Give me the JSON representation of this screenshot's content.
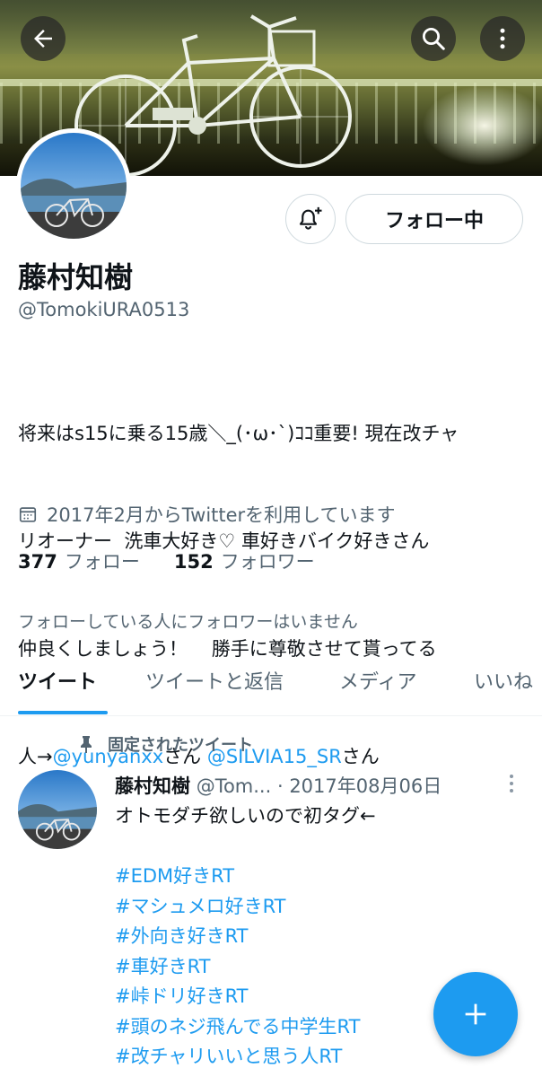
{
  "profile": {
    "name": "藤村知樹",
    "handle": "@TomokiURA0513",
    "bio_lines": [
      "将来はs15に乗る15歳＼_(･ω･`)ｺｺ重要! 現在改チャ",
      "リオーナー  洗車大好き♡ 車好きバイク好きさん",
      "仲良くしましょう！    勝手に尊敬させて貰ってる"
    ],
    "bio_last_prefix": "人→",
    "bio_mention_1": "@yunyanxx",
    "bio_san_1": "さん ",
    "bio_mention_2": "@SILVIA15_SR",
    "bio_san_2": "さん",
    "joined": "2017年2月からTwitterを利用しています",
    "following_count": "377",
    "following_label": "フォロー",
    "followers_count": "152",
    "followers_label": "フォロワー",
    "no_followers_you_know": "フォローしている人にフォロワーはいません",
    "follow_button": "フォロー中"
  },
  "tabs": [
    {
      "label": "ツイート",
      "active": true
    },
    {
      "label": "ツイートと返信",
      "active": false
    },
    {
      "label": "メディア",
      "active": false
    },
    {
      "label": "いいね",
      "active": false
    }
  ],
  "pinned_tweet": {
    "pinned_label": "固定されたツイート",
    "author_name": "藤村知樹",
    "author_handle": "@Tom...",
    "date": "· 2017年08月06日",
    "text_first": "オトモダチ欲しいので初タグ←",
    "hashtags": [
      "#EDM好きRT",
      "#マシュメロ好きRT",
      "#外向き好きRT",
      "#車好きRT",
      "#峠ドリ好きRT",
      "#頭のネジ飛んでる中学生RT",
      "#改チャリいいと思う人RT"
    ]
  },
  "icons": {
    "back": "arrow-left-icon",
    "search": "search-icon",
    "more": "more-vertical-icon",
    "bell": "bell-plus-icon",
    "calendar": "calendar-icon",
    "pin": "pin-icon",
    "compose": "plus-icon"
  },
  "colors": {
    "accent": "#1d9bf0",
    "secondary_text": "#536471",
    "primary_text": "#0f1419"
  }
}
